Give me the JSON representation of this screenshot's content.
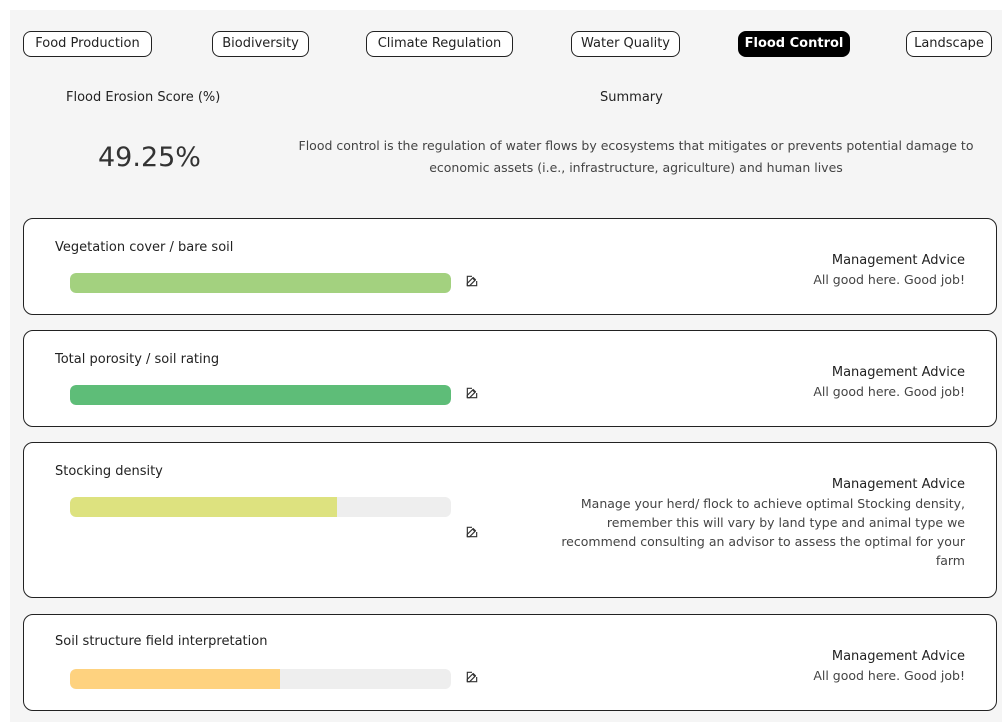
{
  "tabs": [
    {
      "label": "Food Production",
      "active": false
    },
    {
      "label": "Biodiversity",
      "active": false
    },
    {
      "label": "Climate Regulation",
      "active": false
    },
    {
      "label": "Water Quality",
      "active": false
    },
    {
      "label": "Flood Control",
      "active": true
    },
    {
      "label": "Landscape",
      "active": false
    }
  ],
  "score": {
    "label": "Flood Erosion Score (%)",
    "value": "49.25%"
  },
  "summary": {
    "title": "Summary",
    "text": "Flood control is the regulation of water flows by ecosystems that mitigates or prevents potential damage to economic assets (i.e., infrastructure, agriculture) and human lives"
  },
  "metrics": [
    {
      "title": "Vegetation cover / bare soil",
      "progress": 1.0,
      "color": "#a3d17f",
      "advice_title": "Management Advice",
      "advice_text": "All good here. Good job!"
    },
    {
      "title": "Total porosity / soil rating",
      "progress": 1.0,
      "color": "#5ebd78",
      "advice_title": "Management Advice",
      "advice_text": "All good here. Good job!"
    },
    {
      "title": "Stocking density",
      "progress": 0.7,
      "color": "#dde27f",
      "advice_title": "Management Advice",
      "advice_text": "Manage your herd/ flock to achieve optimal Stocking density, remember this will vary by land type and animal type we recommend consulting an advisor to assess the optimal for your farm"
    },
    {
      "title": "Soil structure field interpretation",
      "progress": 0.55,
      "color": "#fed27f",
      "advice_title": "Management Advice",
      "advice_text": "All good here. Good job!"
    }
  ],
  "icons": {
    "edit": "edit-icon"
  }
}
